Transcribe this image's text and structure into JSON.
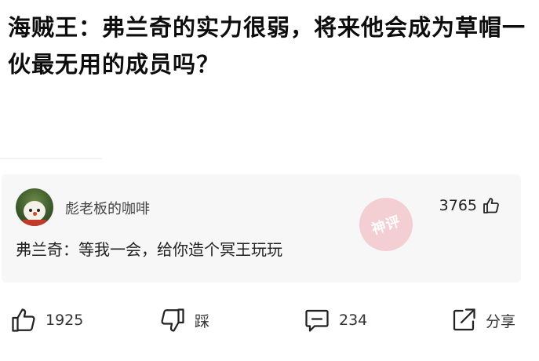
{
  "post": {
    "title": "海贼王：弗兰奇的实力很弱，将来他会成为草帽一伙最无用的成员吗？"
  },
  "top_comment": {
    "username": "彪老板的咖啡",
    "likes": "3765",
    "text": "弗兰奇：等我一会，给你造个冥王玩玩",
    "stamp_text": "神评"
  },
  "actions": {
    "like_count": "1925",
    "dislike_label": "踩",
    "comment_count": "234",
    "share_label": "分享"
  },
  "icons": {
    "thumb_up": "thumbs-up-icon",
    "thumb_down": "thumbs-down-icon",
    "comment": "comment-icon",
    "share": "share-icon"
  }
}
